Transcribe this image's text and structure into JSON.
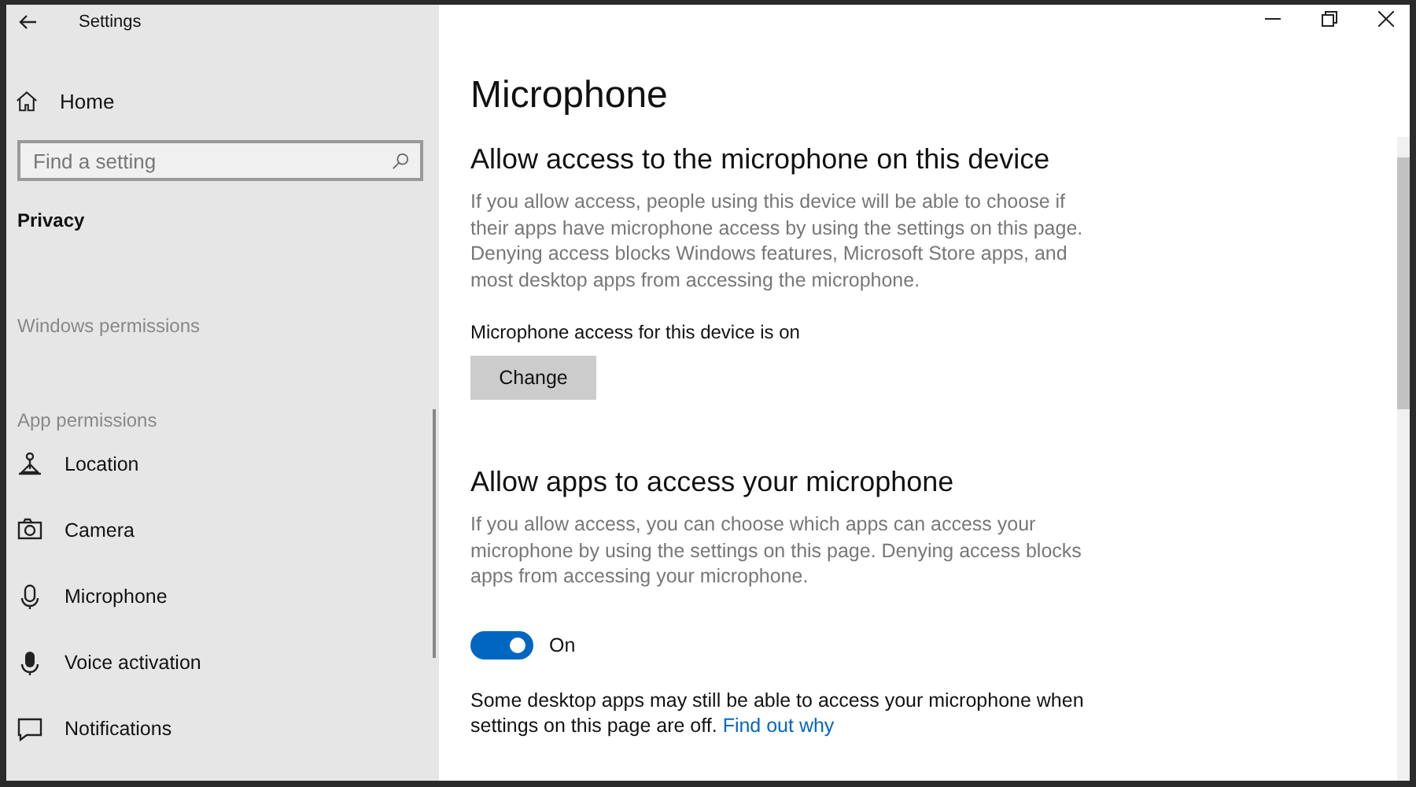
{
  "window": {
    "title": "Settings"
  },
  "sidebar": {
    "home": "Home",
    "search": {
      "placeholder": "Find a setting"
    },
    "category": "Privacy",
    "groups": [
      {
        "heading": "Windows permissions"
      },
      {
        "heading": "App permissions",
        "items": [
          {
            "label": "Location",
            "kind": "location"
          },
          {
            "label": "Camera",
            "kind": "camera"
          },
          {
            "label": "Microphone",
            "kind": "microphone"
          },
          {
            "label": "Voice activation",
            "kind": "voice"
          },
          {
            "label": "Notifications",
            "kind": "notifications"
          }
        ]
      }
    ]
  },
  "page": {
    "title": "Microphone",
    "device_section": {
      "heading": "Allow access to the microphone on this device",
      "description": "If you allow access, people using this device will be able to choose if their apps have microphone access by using the settings on this page. Denying access blocks Windows features, Microsoft Store apps, and most desktop apps from accessing the microphone.",
      "status": "Microphone access for this device is on",
      "button": "Change"
    },
    "apps_section": {
      "heading": "Allow apps to access your microphone",
      "description": "If you allow access, you can choose which apps can access your microphone by using the settings on this page. Denying access blocks apps from accessing your microphone.",
      "toggle": {
        "on": true,
        "label": "On"
      },
      "note": "Some desktop apps may still be able to access your microphone when settings on this page are off.",
      "link": "Find out why"
    }
  }
}
